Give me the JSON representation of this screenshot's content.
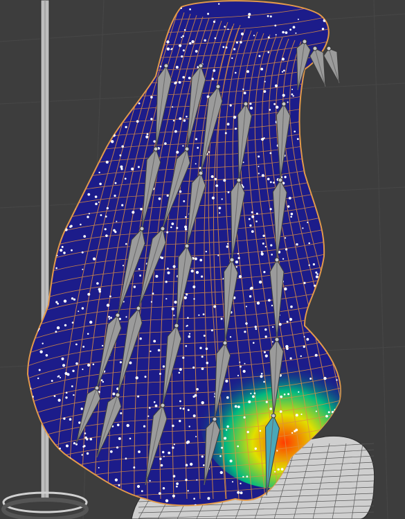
{
  "viewport": {
    "background": "#3d3d3d",
    "grid_color": "#444444"
  },
  "mesh": {
    "hair_weight_color": "#1a1a8c",
    "heat_colors": [
      "#00c060",
      "#c8d800",
      "#ff4000"
    ],
    "edge_color": "#e39a4a",
    "vertex_color": "#ffffff",
    "body_mesh_color": "#d8d8d8"
  },
  "armature": {
    "bone_color": "#9a9a9a",
    "bone_outline": "#4a4a4a",
    "active_bone_color": "#4aa8b8"
  }
}
